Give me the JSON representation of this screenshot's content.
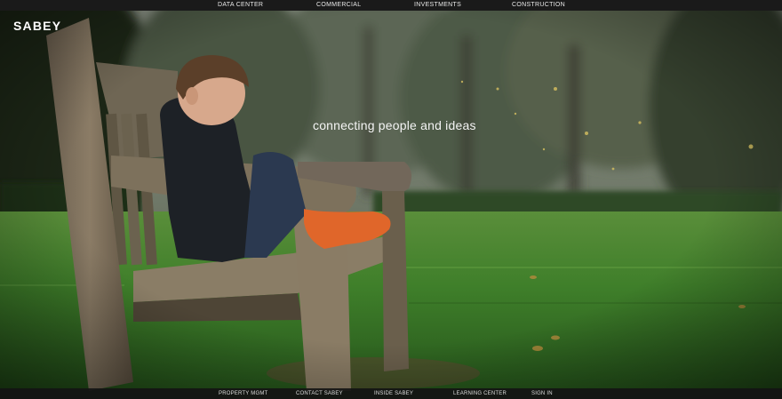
{
  "brand": {
    "logo_text": "SABEY"
  },
  "top_nav": {
    "items": [
      {
        "label": "DATA CENTER"
      },
      {
        "label": "COMMERCIAL"
      },
      {
        "label": "INVESTMENTS"
      },
      {
        "label": "CONSTRUCTION"
      }
    ]
  },
  "hero": {
    "tagline": "connecting people and ideas"
  },
  "bottom_nav": {
    "items": [
      {
        "label": "PROPERTY MGMT"
      },
      {
        "label": "CONTACT SABEY"
      },
      {
        "label": "INSIDE SABEY"
      },
      {
        "label": "LEARNING CENTER"
      },
      {
        "label": "SIGN IN"
      }
    ]
  },
  "colors": {
    "bar_background": "#1a1a1a",
    "nav_text": "#e8e8e8",
    "grass": "#3f7f2a"
  }
}
